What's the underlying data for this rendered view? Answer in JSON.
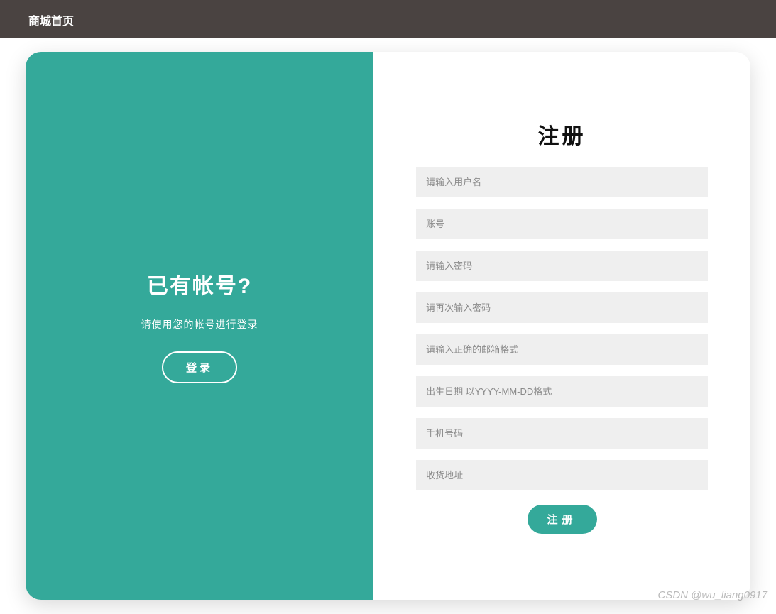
{
  "header": {
    "title": "商城首页"
  },
  "left": {
    "title": "已有帐号?",
    "subtitle": "请使用您的帐号进行登录",
    "login_button": "登录"
  },
  "right": {
    "title": "注册",
    "fields": {
      "username_placeholder": "请输入用户名",
      "account_placeholder": "账号",
      "password_placeholder": "请输入密码",
      "repassword_placeholder": "请再次输入密码",
      "email_placeholder": "请输入正确的邮箱格式",
      "birthday_placeholder": "出生日期 以YYYY-MM-DD格式",
      "phone_placeholder": "手机号码",
      "address_placeholder": "收货地址"
    },
    "submit_button": "注册"
  },
  "watermark": "CSDN @wu_liang0917"
}
